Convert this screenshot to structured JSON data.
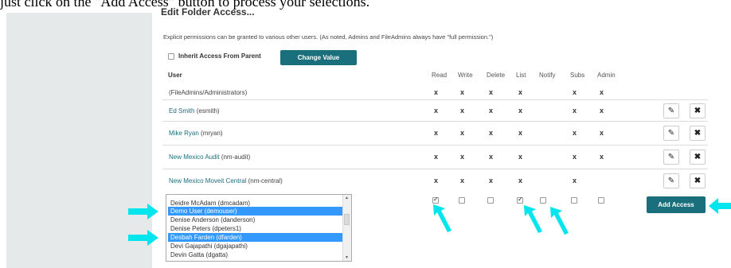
{
  "caption": "just click on the \"Add Access\" button to process your selections.",
  "section": {
    "title": "Edit Folder Access...",
    "explanation": "Explicit permissions can be granted to various other users. (As noted, Admins and FileAdmins always have \"full permission.\")"
  },
  "inherit": {
    "label": "Inherit Access From Parent",
    "checked": false,
    "button": "Change Value"
  },
  "columns": [
    "Read",
    "Write",
    "Delete",
    "List",
    "Notify",
    "Subs",
    "Admin"
  ],
  "user_header": "User",
  "mark_symbol": "x",
  "rows": [
    {
      "name": "",
      "login": "(FileAdmins/Administrators)",
      "perms": [
        1,
        1,
        1,
        1,
        0,
        1,
        1
      ],
      "editable": false
    },
    {
      "name": "Ed Smith",
      "login": "(esmith)",
      "perms": [
        1,
        1,
        1,
        1,
        0,
        1,
        1
      ],
      "editable": true
    },
    {
      "name": "Mike Ryan",
      "login": "(mryan)",
      "perms": [
        1,
        1,
        1,
        1,
        0,
        1,
        1
      ],
      "editable": true
    },
    {
      "name": "New Mexico Audit ",
      "login": "(nm-audit)",
      "perms": [
        1,
        1,
        1,
        1,
        0,
        1,
        1
      ],
      "editable": true
    },
    {
      "name": "New Mexico Moveit Central",
      "login": "(nm-central)",
      "perms": [
        1,
        1,
        1,
        1,
        0,
        1,
        0
      ],
      "editable": true
    }
  ],
  "user_list": [
    {
      "label": "Deidre McAdam (dmcadam)",
      "selected": false
    },
    {
      "label": "Demo User (demouser)",
      "selected": true
    },
    {
      "label": "Denise Anderson (danderson)",
      "selected": false
    },
    {
      "label": "Denise Peters (dpeters1)",
      "selected": false
    },
    {
      "label": "Desbah Farden (dfarden)",
      "selected": true
    },
    {
      "label": "Devi Gajapathi (dgajapathi)",
      "selected": false
    },
    {
      "label": "Devin Gatta  (dgatta)",
      "selected": false
    }
  ],
  "new_perms": [
    true,
    false,
    false,
    true,
    false,
    false,
    false
  ],
  "add_button": "Add Access",
  "icons": {
    "edit": "pencil-icon",
    "delete": "close-icon",
    "callout": "arrow-icon"
  },
  "colors": {
    "accent": "#1a6f7d",
    "selection": "#3399ff",
    "callout": "#00e5ee"
  }
}
